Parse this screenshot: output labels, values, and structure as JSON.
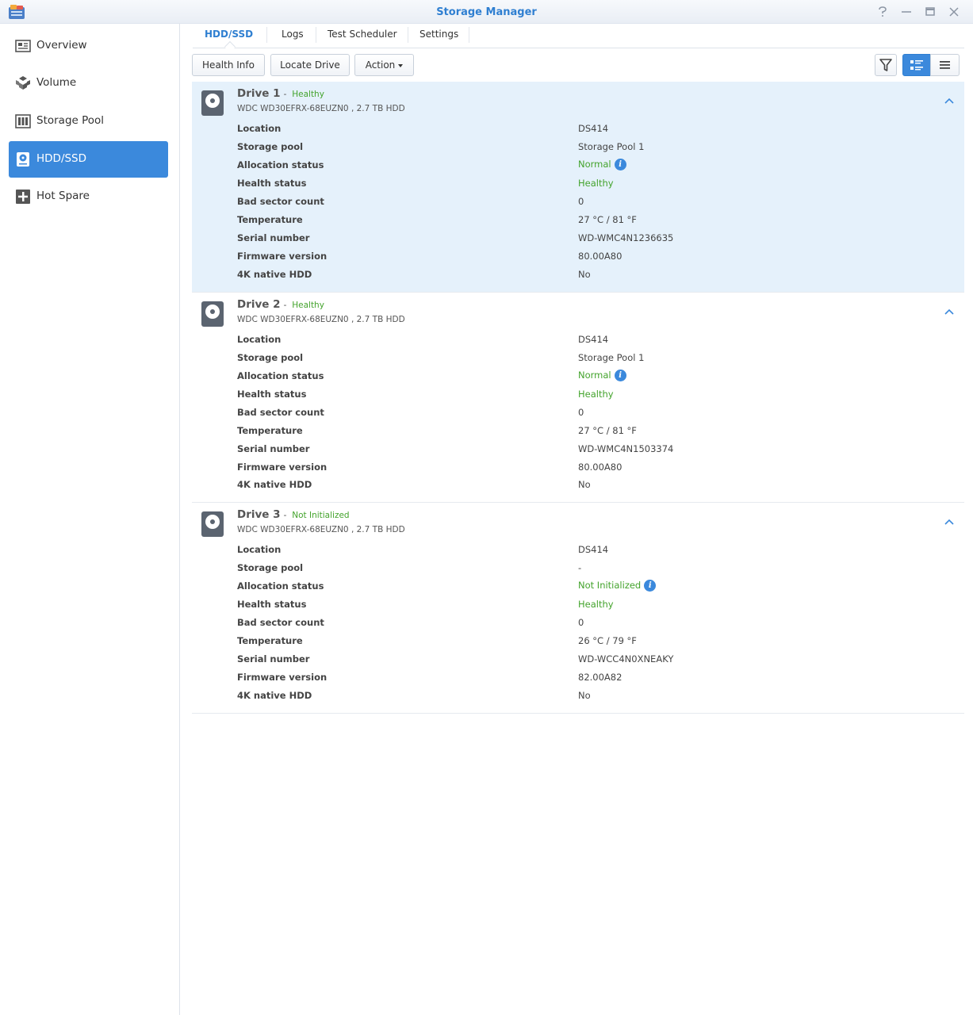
{
  "window": {
    "title": "Storage Manager"
  },
  "sidebar": {
    "items": [
      {
        "label": "Overview",
        "icon": "overview-icon"
      },
      {
        "label": "Volume",
        "icon": "volume-icon"
      },
      {
        "label": "Storage Pool",
        "icon": "storage-pool-icon"
      },
      {
        "label": "HDD/SSD",
        "icon": "hdd-icon",
        "active": true
      },
      {
        "label": "Hot Spare",
        "icon": "hot-spare-icon"
      }
    ]
  },
  "tabs": [
    {
      "label": "HDD/SSD",
      "active": true
    },
    {
      "label": "Logs"
    },
    {
      "label": "Test Scheduler"
    },
    {
      "label": "Settings"
    }
  ],
  "toolbar": {
    "health_info": "Health Info",
    "locate_drive": "Locate Drive",
    "action": "Action"
  },
  "row_labels": {
    "location": "Location",
    "storage_pool": "Storage pool",
    "allocation_status": "Allocation status",
    "health_status": "Health status",
    "bad_sector_count": "Bad sector count",
    "temperature": "Temperature",
    "serial_number": "Serial number",
    "firmware_version": "Firmware version",
    "native_4k": "4K native HDD"
  },
  "drives": [
    {
      "name": "Drive 1",
      "status": "Healthy",
      "model": "WDC WD30EFRX-68EUZN0 , 2.7 TB HDD",
      "location": "DS414",
      "storage_pool": "Storage Pool 1",
      "allocation_status": "Normal",
      "health_status": "Healthy",
      "bad_sector_count": "0",
      "temperature": "27 °C / 81 °F",
      "serial_number": "WD-WMC4N1236635",
      "firmware_version": "80.00A80",
      "native_4k": "No"
    },
    {
      "name": "Drive 2",
      "status": "Healthy",
      "model": "WDC WD30EFRX-68EUZN0 , 2.7 TB HDD",
      "location": "DS414",
      "storage_pool": "Storage Pool 1",
      "allocation_status": "Normal",
      "health_status": "Healthy",
      "bad_sector_count": "0",
      "temperature": "27 °C / 81 °F",
      "serial_number": "WD-WMC4N1503374",
      "firmware_version": "80.00A80",
      "native_4k": "No"
    },
    {
      "name": "Drive 3",
      "status": "Not Initialized",
      "model": "WDC WD30EFRX-68EUZN0 , 2.7 TB HDD",
      "location": "DS414",
      "storage_pool": "-",
      "allocation_status": "Not Initialized",
      "health_status": "Healthy",
      "bad_sector_count": "0",
      "temperature": "26 °C / 79 °F",
      "serial_number": "WD-WCC4N0XNEAKY",
      "firmware_version": "82.00A82",
      "native_4k": "No"
    }
  ],
  "colors": {
    "accent": "#3b89dc",
    "title": "#2f7fd1",
    "healthy": "#43a32c",
    "selected_bg": "#e5f1fb"
  }
}
